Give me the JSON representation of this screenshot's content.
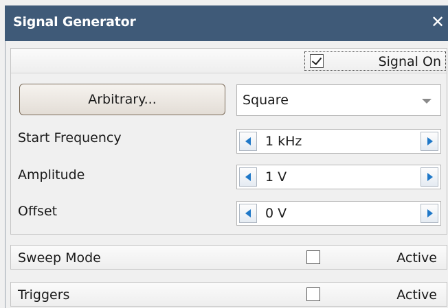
{
  "window": {
    "title": "Signal Generator",
    "close_glyph": "✕",
    "close_icon": "close-icon"
  },
  "signal": {
    "label": "Signal On",
    "checked": true
  },
  "waveform": {
    "arbitrary_button": "Arbitrary...",
    "selected": "Square"
  },
  "fields": {
    "start_frequency": {
      "label": "Start Frequency",
      "value": "1 kHz"
    },
    "amplitude": {
      "label": "Amplitude",
      "value": "1 V"
    },
    "offset": {
      "label": "Offset",
      "value": "0 V"
    }
  },
  "sweep": {
    "label": "Sweep Mode",
    "active_label": "Active",
    "checked": false
  },
  "triggers": {
    "label": "Triggers",
    "active_label": "Active",
    "checked": false
  },
  "colors": {
    "titlebar": "#3f5a78",
    "spinner_arrow": "#1f78c8"
  }
}
